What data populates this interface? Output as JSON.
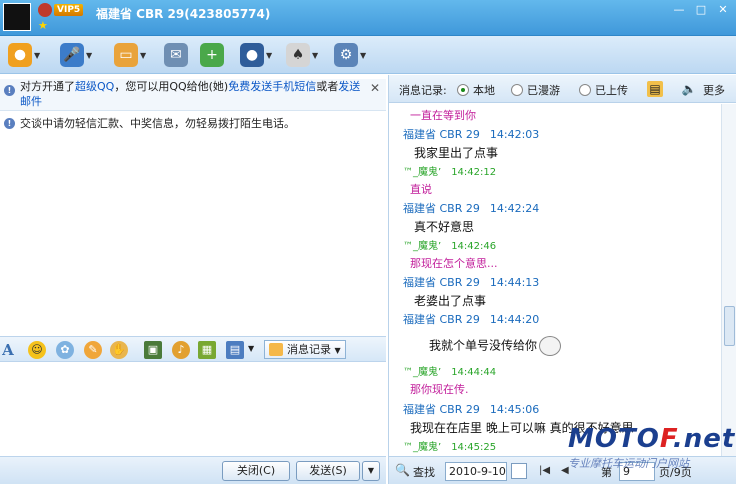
{
  "window": {
    "title": "福建省 CBR 29(423805774)",
    "vip": "VIP5",
    "controls": [
      "—",
      "□",
      "✕"
    ]
  },
  "toolbar": {
    "icons": [
      "video-icon",
      "voice-icon",
      "folder-icon",
      "email-icon",
      "sms-icon",
      "app-icon",
      "game-icon",
      "settings-icon"
    ]
  },
  "notices": {
    "n1_a": "对方开通了",
    "n1_link1": "超级QQ",
    "n1_b": "，您可以用QQ给他(她)",
    "n1_link2": "免费发送手机短信",
    "n1_c": "或者",
    "n1_link3": "发送邮件",
    "n2": "交谈中请勿轻信汇款、中奖信息，勿轻易拨打陌生电话。"
  },
  "format_bar": {
    "msg_record_label": "消息记录"
  },
  "buttons": {
    "close": "关闭(C)",
    "send": "发送(S)"
  },
  "history": {
    "label": "消息记录:",
    "opt_local": "本地",
    "opt_roam": "已漫游",
    "opt_upload": "已上传",
    "more": "更多",
    "search": "查找",
    "date": "2010-9-10",
    "page_prefix": "第",
    "page": "9",
    "page_suffix": "页/9页",
    "messages": [
      {
        "type": "text-b",
        "text": "一直在等到你"
      },
      {
        "type": "sender-a",
        "name": "福建省 CBR 29",
        "time": "14:42:03"
      },
      {
        "type": "text-a",
        "text": "我家里出了点事"
      },
      {
        "type": "sender-b",
        "name": "™_魔鬼’",
        "time": "14:42:12"
      },
      {
        "type": "text-b",
        "text": "直说"
      },
      {
        "type": "sender-a",
        "name": "福建省 CBR 29",
        "time": "14:42:24"
      },
      {
        "type": "text-a",
        "text": "真不好意思"
      },
      {
        "type": "sender-b",
        "name": "™_魔鬼’",
        "time": "14:42:46"
      },
      {
        "type": "text-b",
        "text": "那现在怎个意思..."
      },
      {
        "type": "sender-a",
        "name": "福建省 CBR 29",
        "time": "14:44:13"
      },
      {
        "type": "text-a",
        "text": "老婆出了点事"
      },
      {
        "type": "sender-a",
        "name": "福建省 CBR 29",
        "time": "14:44:20"
      },
      {
        "type": "text-a",
        "text": "我就个单号没传给你"
      },
      {
        "type": "sender-b",
        "name": "™_魔鬼’",
        "time": "14:44:44"
      },
      {
        "type": "text-b",
        "text": "那你现在传."
      },
      {
        "type": "sender-a",
        "name": "福建省 CBR 29",
        "time": "14:45:06"
      },
      {
        "type": "text-a",
        "text": "我现在在店里 晚上可以嘛  真的很不好意思"
      },
      {
        "type": "sender-b",
        "name": "™_魔鬼’",
        "time": "14:45:25"
      }
    ]
  },
  "watermark": {
    "brand_m": "MOTO",
    "brand_f": "F",
    "brand_tail": ".net",
    "subtitle": "专业摩托车运动门户网站"
  }
}
